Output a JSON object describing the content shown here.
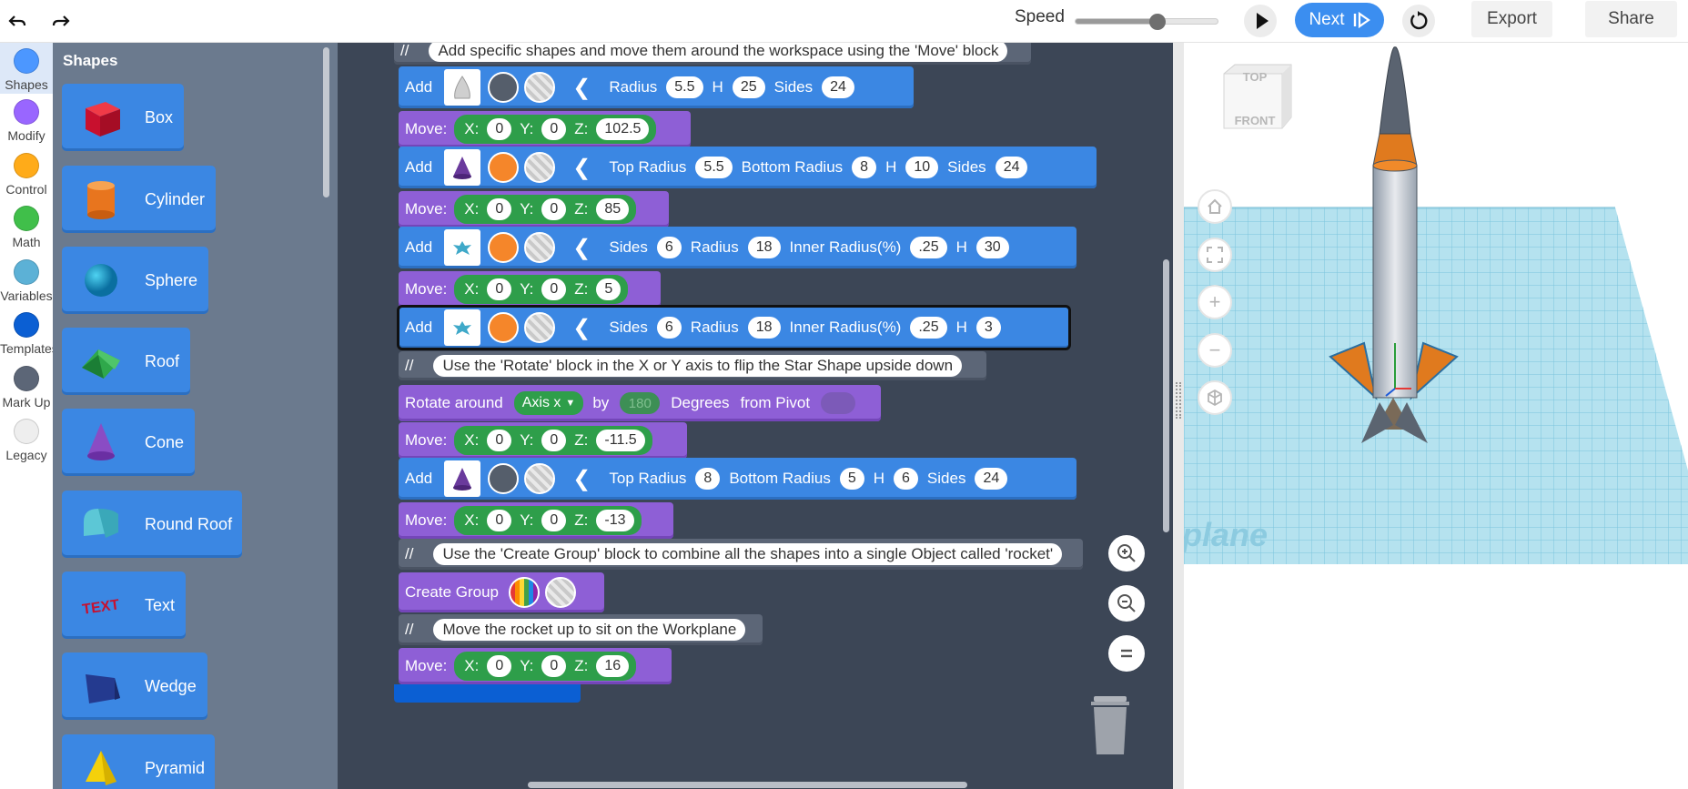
{
  "topbar": {
    "undo_icon": "undo-icon",
    "redo_icon": "redo-icon",
    "speed_label": "Speed",
    "speed_value": 0.58,
    "next_label": "Next",
    "export_label": "Export",
    "share_label": "Share"
  },
  "categories": [
    {
      "label": "Shapes",
      "color": "#4c97ff",
      "active": true
    },
    {
      "label": "Modify",
      "color": "#9966ff"
    },
    {
      "label": "Control",
      "color": "#ffab19"
    },
    {
      "label": "Math",
      "color": "#40bf4a"
    },
    {
      "label": "Variables",
      "color": "#5cb1d6"
    },
    {
      "label": "Templates",
      "color": "#0b5fd3"
    },
    {
      "label": "Mark Up",
      "color": "#5c6677"
    },
    {
      "label": "Legacy",
      "color": "#eeeeee"
    }
  ],
  "flyout": {
    "title": "Shapes",
    "items": [
      "Box",
      "Cylinder",
      "Sphere",
      "Roof",
      "Cone",
      "Round Roof",
      "Text",
      "Wedge",
      "Pyramid"
    ]
  },
  "workspace": {
    "comment_top": "Add specific shapes and move them around the workspace using the 'Move' block",
    "add_kw": "Add",
    "move_kw": "Move:",
    "comment_kw": "//",
    "x_lbl": "X:",
    "y_lbl": "Y:",
    "z_lbl": "Z:",
    "radius_lbl": "Radius",
    "h_lbl": "H",
    "sides_lbl": "Sides",
    "top_radius_lbl": "Top Radius",
    "bottom_radius_lbl": "Bottom Radius",
    "inner_radius_lbl": "Inner Radius(%)",
    "add1": {
      "radius": "5.5",
      "h": "25",
      "sides": "24"
    },
    "move1": {
      "x": "0",
      "y": "0",
      "z": "102.5"
    },
    "add2": {
      "top_radius": "5.5",
      "bottom_radius": "8",
      "h": "10",
      "sides": "24"
    },
    "move2": {
      "x": "0",
      "y": "0",
      "z": "85"
    },
    "add3": {
      "sides": "6",
      "radius": "18",
      "inner_radius": ".25",
      "h": "30"
    },
    "move3": {
      "x": "0",
      "y": "0",
      "z": "5"
    },
    "add4": {
      "sides": "6",
      "radius": "18",
      "inner_radius": ".25",
      "h": "3"
    },
    "comment_rotate": "Use the 'Rotate' block in the X or Y axis to flip the Star Shape upside down",
    "rotate": {
      "kw": "Rotate around",
      "axis": "Axis x",
      "by": "by",
      "degrees_val": "180",
      "degrees": "Degrees",
      "pivot": "from Pivot"
    },
    "move4": {
      "x": "0",
      "y": "0",
      "z": "-11.5"
    },
    "add5": {
      "top_radius": "8",
      "bottom_radius": "5",
      "h": "6",
      "sides": "24"
    },
    "move5": {
      "x": "0",
      "y": "0",
      "z": "-13"
    },
    "comment_group": "Use the 'Create Group' block to combine all the shapes into a single Object called 'rocket'",
    "group_kw": "Create Group",
    "comment_move_up": "Move the rocket up to sit on the Workplane",
    "move6": {
      "x": "0",
      "y": "0",
      "z": "16"
    }
  },
  "viewport": {
    "cube_top": "TOP",
    "cube_front": "FRONT",
    "workplane_text": "plane"
  },
  "colors": {
    "orange": "#f5862a",
    "dark": "#555e6b",
    "cone_purple": "#6a3a9c"
  }
}
